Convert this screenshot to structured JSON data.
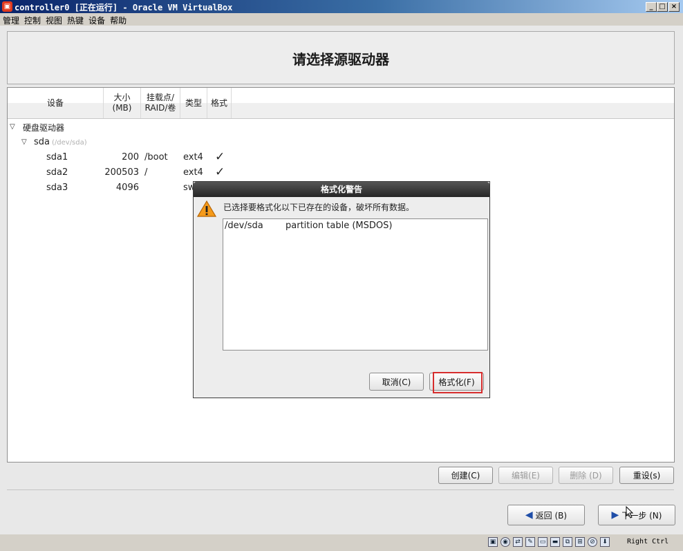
{
  "window": {
    "title": "controller0 [正在运行] - Oracle VM VirtualBox",
    "min": "_",
    "max": "□",
    "close": "×"
  },
  "menu": [
    "管理",
    "控制",
    "视图",
    "热键",
    "设备",
    "帮助"
  ],
  "header": {
    "title": "请选择源驱动器"
  },
  "columns": {
    "device": "设备",
    "size": "大小\n(MB)",
    "mount": "挂载点/\nRAID/卷",
    "type": "类型",
    "format": "格式"
  },
  "tree": {
    "group_label": "硬盘驱动器",
    "disk_name": "sda",
    "disk_path": "(/dev/sda)",
    "partitions": [
      {
        "name": "sda1",
        "size": "200",
        "mount": "/boot",
        "type": "ext4",
        "format": "✓"
      },
      {
        "name": "sda2",
        "size": "200503",
        "mount": "/",
        "type": "ext4",
        "format": "✓"
      },
      {
        "name": "sda3",
        "size": "4096",
        "mount": "",
        "type": "sw",
        "format": ""
      }
    ]
  },
  "buttons": {
    "create": "创建(C)",
    "edit": "编辑(E)",
    "delete": "删除 (D)",
    "reset": "重设(s)",
    "back": "返回 (B)",
    "next": "下一步 (N)"
  },
  "dialog": {
    "title": "格式化警告",
    "message": "已选择要格式化以下已存在的设备，破坏所有数据。",
    "items": [
      {
        "device": "/dev/sda",
        "desc": "partition table (MSDOS)"
      }
    ],
    "cancel": "取消(C)",
    "format": "格式化(F)"
  },
  "statusbar": {
    "host_key": "Right Ctrl"
  },
  "colors": {
    "highlight": "#d62d2d",
    "title_dark": "#262626",
    "nav_arrow": "#1f4ea8"
  }
}
